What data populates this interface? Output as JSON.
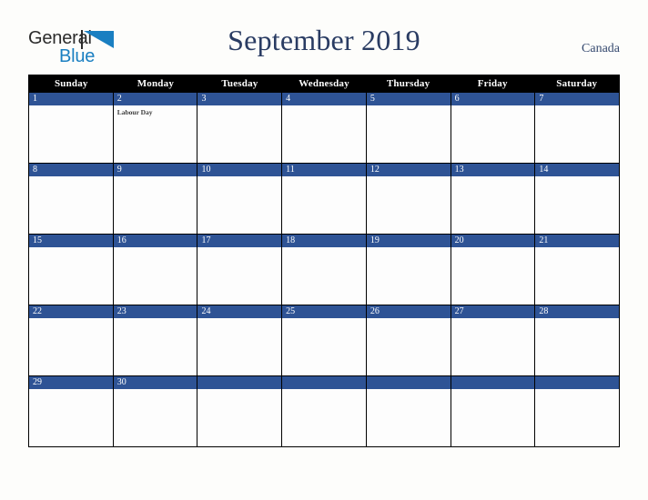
{
  "brand": {
    "name_part1": "General",
    "name_part2": "Blue",
    "triangle_icon": "triangle-icon",
    "colors": {
      "dark": "#2b2b2b",
      "blue": "#1a7fc1"
    }
  },
  "header": {
    "title": "September 2019",
    "country": "Canada",
    "title_color": "#2a3c63"
  },
  "calendar": {
    "month": "September",
    "year": "2019",
    "weekday_headers": [
      "Sunday",
      "Monday",
      "Tuesday",
      "Wednesday",
      "Thursday",
      "Friday",
      "Saturday"
    ],
    "colors": {
      "header_background": "#000000",
      "header_text": "#ffffff",
      "date_bar": "#2e5395",
      "date_text": "#ffffff",
      "cell_background": "#fdfdfd",
      "grid_line": "#000000"
    },
    "weeks": [
      [
        {
          "date": "1",
          "events": []
        },
        {
          "date": "2",
          "events": [
            "Labour Day"
          ]
        },
        {
          "date": "3",
          "events": []
        },
        {
          "date": "4",
          "events": []
        },
        {
          "date": "5",
          "events": []
        },
        {
          "date": "6",
          "events": []
        },
        {
          "date": "7",
          "events": []
        }
      ],
      [
        {
          "date": "8",
          "events": []
        },
        {
          "date": "9",
          "events": []
        },
        {
          "date": "10",
          "events": []
        },
        {
          "date": "11",
          "events": []
        },
        {
          "date": "12",
          "events": []
        },
        {
          "date": "13",
          "events": []
        },
        {
          "date": "14",
          "events": []
        }
      ],
      [
        {
          "date": "15",
          "events": []
        },
        {
          "date": "16",
          "events": []
        },
        {
          "date": "17",
          "events": []
        },
        {
          "date": "18",
          "events": []
        },
        {
          "date": "19",
          "events": []
        },
        {
          "date": "20",
          "events": []
        },
        {
          "date": "21",
          "events": []
        }
      ],
      [
        {
          "date": "22",
          "events": []
        },
        {
          "date": "23",
          "events": []
        },
        {
          "date": "24",
          "events": []
        },
        {
          "date": "25",
          "events": []
        },
        {
          "date": "26",
          "events": []
        },
        {
          "date": "27",
          "events": []
        },
        {
          "date": "28",
          "events": []
        }
      ],
      [
        {
          "date": "29",
          "events": []
        },
        {
          "date": "30",
          "events": []
        },
        {
          "date": "",
          "events": []
        },
        {
          "date": "",
          "events": []
        },
        {
          "date": "",
          "events": []
        },
        {
          "date": "",
          "events": []
        },
        {
          "date": "",
          "events": []
        }
      ]
    ]
  }
}
